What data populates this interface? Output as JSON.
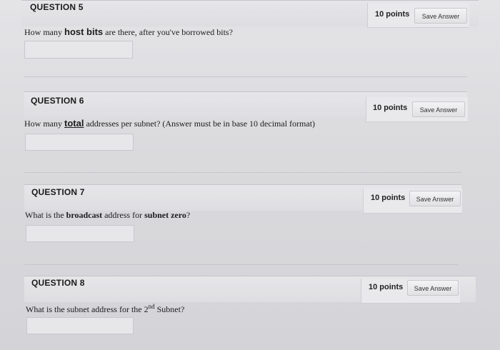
{
  "questions": [
    {
      "title": "QUESTION 5",
      "points": "10 points",
      "save_label": "Save Answer",
      "text_before": "How many ",
      "text_emph": "host bits",
      "text_after": " are there, after you've borrowed bits?",
      "answer_value": ""
    },
    {
      "title": "QUESTION 6",
      "points": "10 points",
      "save_label": "Save Answer",
      "text_before": "How many ",
      "text_emph": "total",
      "text_after": " addresses per subnet? (Answer must be in base 10 decimal format)",
      "answer_value": ""
    },
    {
      "title": "QUESTION 7",
      "points": "10 points",
      "save_label": "Save Answer",
      "text_before": "What is the ",
      "text_emph": "broadcast",
      "text_mid": " address for ",
      "text_emph2": "subnet zero",
      "text_after": "?",
      "answer_value": ""
    },
    {
      "title": "QUESTION 8",
      "points": "10 points",
      "save_label": "Save Answer",
      "text_before": "What is the subnet address for the 2",
      "text_sup": "nd",
      "text_after": " Subnet?",
      "answer_value": ""
    }
  ]
}
